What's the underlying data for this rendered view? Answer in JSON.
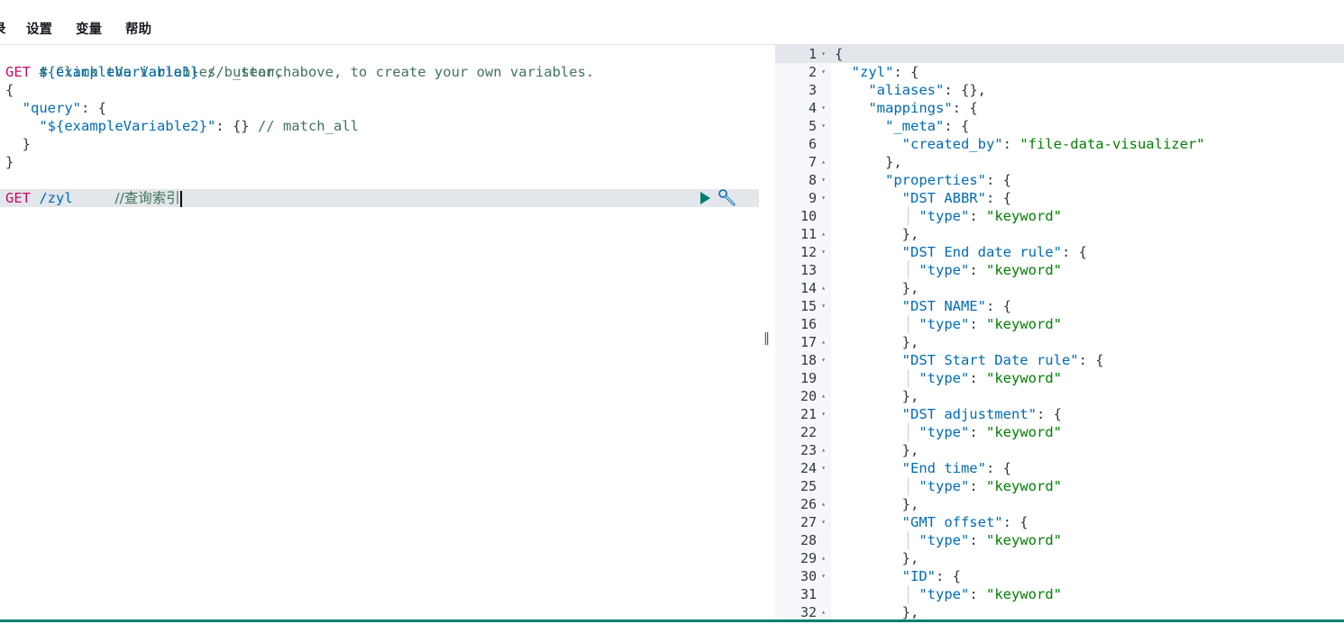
{
  "menu": {
    "items": [
      {
        "label": "设置"
      },
      {
        "label": "变量"
      },
      {
        "label": "帮助"
      }
    ],
    "cut_label": "录"
  },
  "request_editor": {
    "lines": {
      "l1": "# Click the Variables button, above, to create your own variables.",
      "l2_method": "GET",
      "l2_path": "${exampleVariable1}",
      "l2_comment": "// _search",
      "l3": "{",
      "l4_key": "\"query\"",
      "l4_rest": ": {",
      "l5_key": "\"${exampleVariable2}\"",
      "l5_rest": ": {}",
      "l5_comment": "// match_all",
      "l6": "}",
      "l7": "}",
      "l9_method": "GET",
      "l9_path": "/zyl",
      "l9_comment": "//查询索引"
    },
    "actions": {
      "run_icon": "play-icon",
      "settings_icon": "wrench-icon"
    }
  },
  "response_viewer": {
    "line_numbers": [
      "1",
      "2",
      "3",
      "4",
      "5",
      "6",
      "7",
      "8",
      "9",
      "10",
      "11",
      "12",
      "13",
      "14",
      "15",
      "16",
      "17",
      "18",
      "19",
      "20",
      "21",
      "22",
      "23",
      "24",
      "25",
      "26",
      "27",
      "28",
      "29",
      "30",
      "31",
      "32"
    ],
    "fold_markers": [
      "▾",
      "▾",
      "",
      "▾",
      "▾",
      "",
      "▴",
      "▾",
      "▾",
      "",
      "▴",
      "▾",
      "",
      "▴",
      "▾",
      "",
      "▴",
      "▾",
      "",
      "▴",
      "▾",
      "",
      "▴",
      "▾",
      "",
      "▴",
      "▾",
      "",
      "▴",
      "▾",
      "",
      "▴"
    ],
    "index_name": "\"zyl\"",
    "keys": {
      "aliases": "\"aliases\"",
      "mappings": "\"mappings\"",
      "meta": "\"_meta\"",
      "created_by": "\"created_by\"",
      "created_by_value": "\"file-data-visualizer\"",
      "properties": "\"properties\"",
      "type": "\"type\"",
      "keyword": "\"keyword\""
    },
    "fields": [
      "\"DST ABBR\"",
      "\"DST End date rule\"",
      "\"DST NAME\"",
      "\"DST Start Date rule\"",
      "\"DST adjustment\"",
      "\"End time\"",
      "\"GMT offset\"",
      "\"ID\""
    ],
    "punct": {
      "open": "{",
      "obj_open": ": {",
      "empty_obj": ": {},",
      "close_comma": "},",
      "colon": ": "
    }
  },
  "colors": {
    "method": "#c80a68",
    "path": "#006bb8",
    "string": "#008000",
    "comment": "#41755c",
    "active_line": "#e3e6ea",
    "run": "#017d73",
    "wrench": "#006bb8"
  }
}
